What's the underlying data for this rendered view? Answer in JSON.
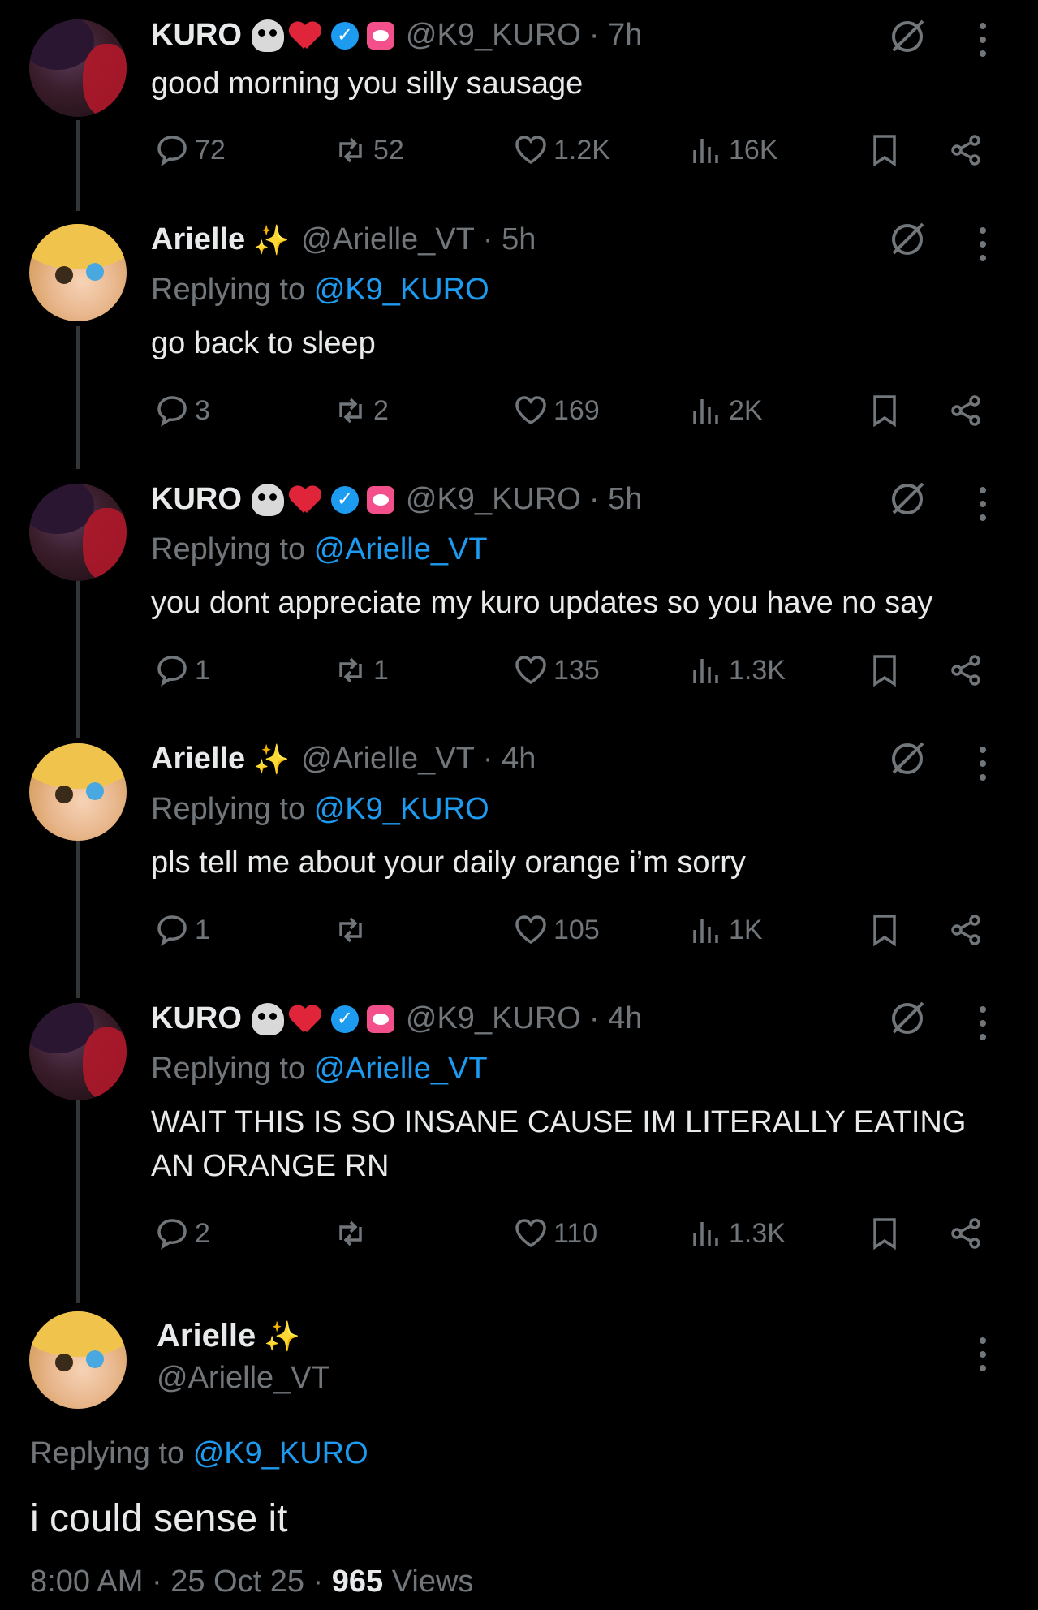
{
  "tweets": [
    {
      "author": "kuro",
      "name": "KURO",
      "handle": "@K9_KURO",
      "time": "· 7h",
      "replying_to": "",
      "text": "good morning you silly sausage",
      "stats": {
        "replies": "72",
        "reposts": "52",
        "likes": "1.2K",
        "views": "16K"
      }
    },
    {
      "author": "arielle",
      "name": "Arielle",
      "handle": "@Arielle_VT",
      "time": "· 5h",
      "replying_prefix": "Replying to",
      "replying_to": "@K9_KURO",
      "text": "go back to sleep",
      "stats": {
        "replies": "3",
        "reposts": "2",
        "likes": "169",
        "views": "2K"
      }
    },
    {
      "author": "kuro",
      "name": "KURO",
      "handle": "@K9_KURO",
      "time": "· 5h",
      "replying_prefix": "Replying to",
      "replying_to": "@Arielle_VT",
      "text": "you dont appreciate my kuro updates so you have no say",
      "stats": {
        "replies": "1",
        "reposts": "1",
        "likes": "135",
        "views": "1.3K"
      }
    },
    {
      "author": "arielle",
      "name": "Arielle",
      "handle": "@Arielle_VT",
      "time": "· 4h",
      "replying_prefix": "Replying to",
      "replying_to": "@K9_KURO",
      "text": "pls tell me about your daily orange i’m sorry",
      "stats": {
        "replies": "1",
        "reposts": "",
        "likes": "105",
        "views": "1K"
      }
    },
    {
      "author": "kuro",
      "name": "KURO",
      "handle": "@K9_KURO",
      "time": "· 4h",
      "replying_prefix": "Replying to",
      "replying_to": "@Arielle_VT",
      "text": "WAIT THIS IS SO INSANE CAUSE IM LITERALLY EATING AN ORANGE RN",
      "stats": {
        "replies": "2",
        "reposts": "",
        "likes": "110",
        "views": "1.3K"
      }
    }
  ],
  "main_tweet": {
    "name": "Arielle",
    "handle": "@Arielle_VT",
    "replying_prefix": "Replying to",
    "replying_to": "@K9_KURO",
    "text": "i could sense it",
    "time": "8:00 AM",
    "date": "25 Oct 25",
    "views_count": "965",
    "views_label": "Views",
    "separator": "·"
  },
  "colors": {
    "background": "#000000",
    "text": "#e7e9ea",
    "muted": "#71767b",
    "link": "#1d9bf0"
  }
}
